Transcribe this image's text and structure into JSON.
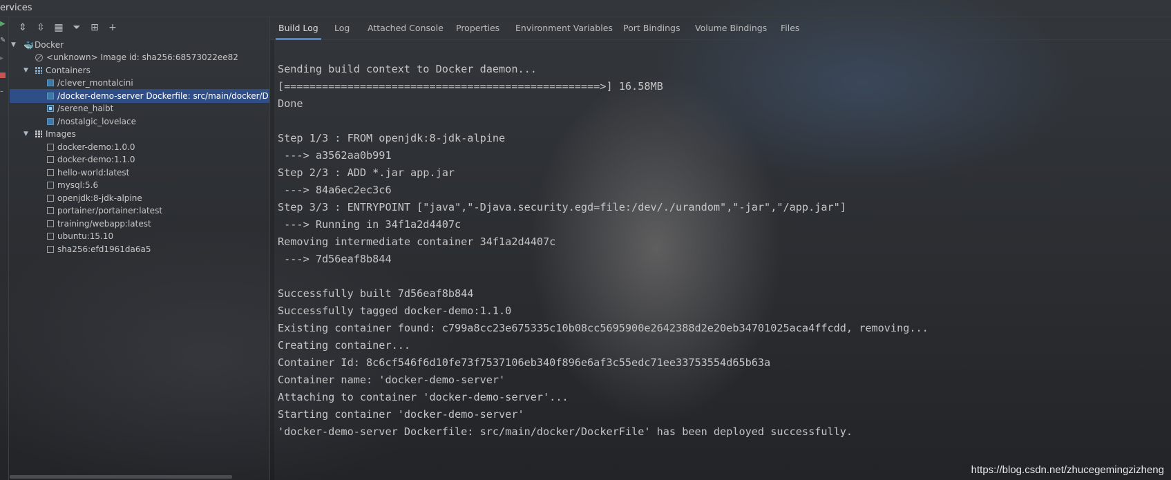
{
  "window": {
    "title": "ervices"
  },
  "toolbar": {
    "icons": [
      "expand-all-icon",
      "collapse-all-icon",
      "group-icon",
      "filter-icon",
      "new-window-icon",
      "add-icon"
    ]
  },
  "tree": {
    "docker_label": "Docker",
    "unknown_label": "<unknown>  Image id: sha256:68573022ee82",
    "containers_label": "Containers",
    "containers": [
      "/clever_montalcini",
      "/docker-demo-server Dockerfile: src/main/docker/D",
      "/serene_haibt",
      "/nostalgic_lovelace"
    ],
    "images_label": "Images",
    "images": [
      "docker-demo:1.0.0",
      "docker-demo:1.1.0",
      "hello-world:latest",
      "mysql:5.6",
      "openjdk:8-jdk-alpine",
      "portainer/portainer:latest",
      "training/webapp:latest",
      "ubuntu:15.10",
      "sha256:efd1961da6a5"
    ]
  },
  "tabs": [
    "Build Log",
    "Log",
    "Attached Console",
    "Properties",
    "Environment Variables",
    "Port Bindings",
    "Volume Bindings",
    "Files"
  ],
  "console": [
    "",
    "Sending build context to Docker daemon...",
    "[==================================================>] 16.58MB",
    "Done",
    "",
    "Step 1/3 : FROM openjdk:8-jdk-alpine",
    " ---> a3562aa0b991",
    "Step 2/3 : ADD *.jar app.jar",
    " ---> 84a6ec2ec3c6",
    "Step 3/3 : ENTRYPOINT [\"java\",\"-Djava.security.egd=file:/dev/./urandom\",\"-jar\",\"/app.jar\"]",
    " ---> Running in 34f1a2d4407c",
    "Removing intermediate container 34f1a2d4407c",
    " ---> 7d56eaf8b844",
    "",
    "Successfully built 7d56eaf8b844",
    "Successfully tagged docker-demo:1.1.0",
    "Existing container found: c799a8cc23e675335c10b08cc5695900e2642388d2e20eb34701025aca4ffcdd, removing...",
    "Creating container...",
    "Container Id: 8c6cf546f6d10fe73f7537106eb340f896e6af3c55edc71ee33753554d65b63a",
    "Container name: 'docker-demo-server'",
    "Attaching to container 'docker-demo-server'...",
    "Starting container 'docker-demo-server'",
    "'docker-demo-server Dockerfile: src/main/docker/DockerFile' has been deployed successfully."
  ],
  "watermark": "https://blog.csdn.net/zhucegemingzizheng"
}
